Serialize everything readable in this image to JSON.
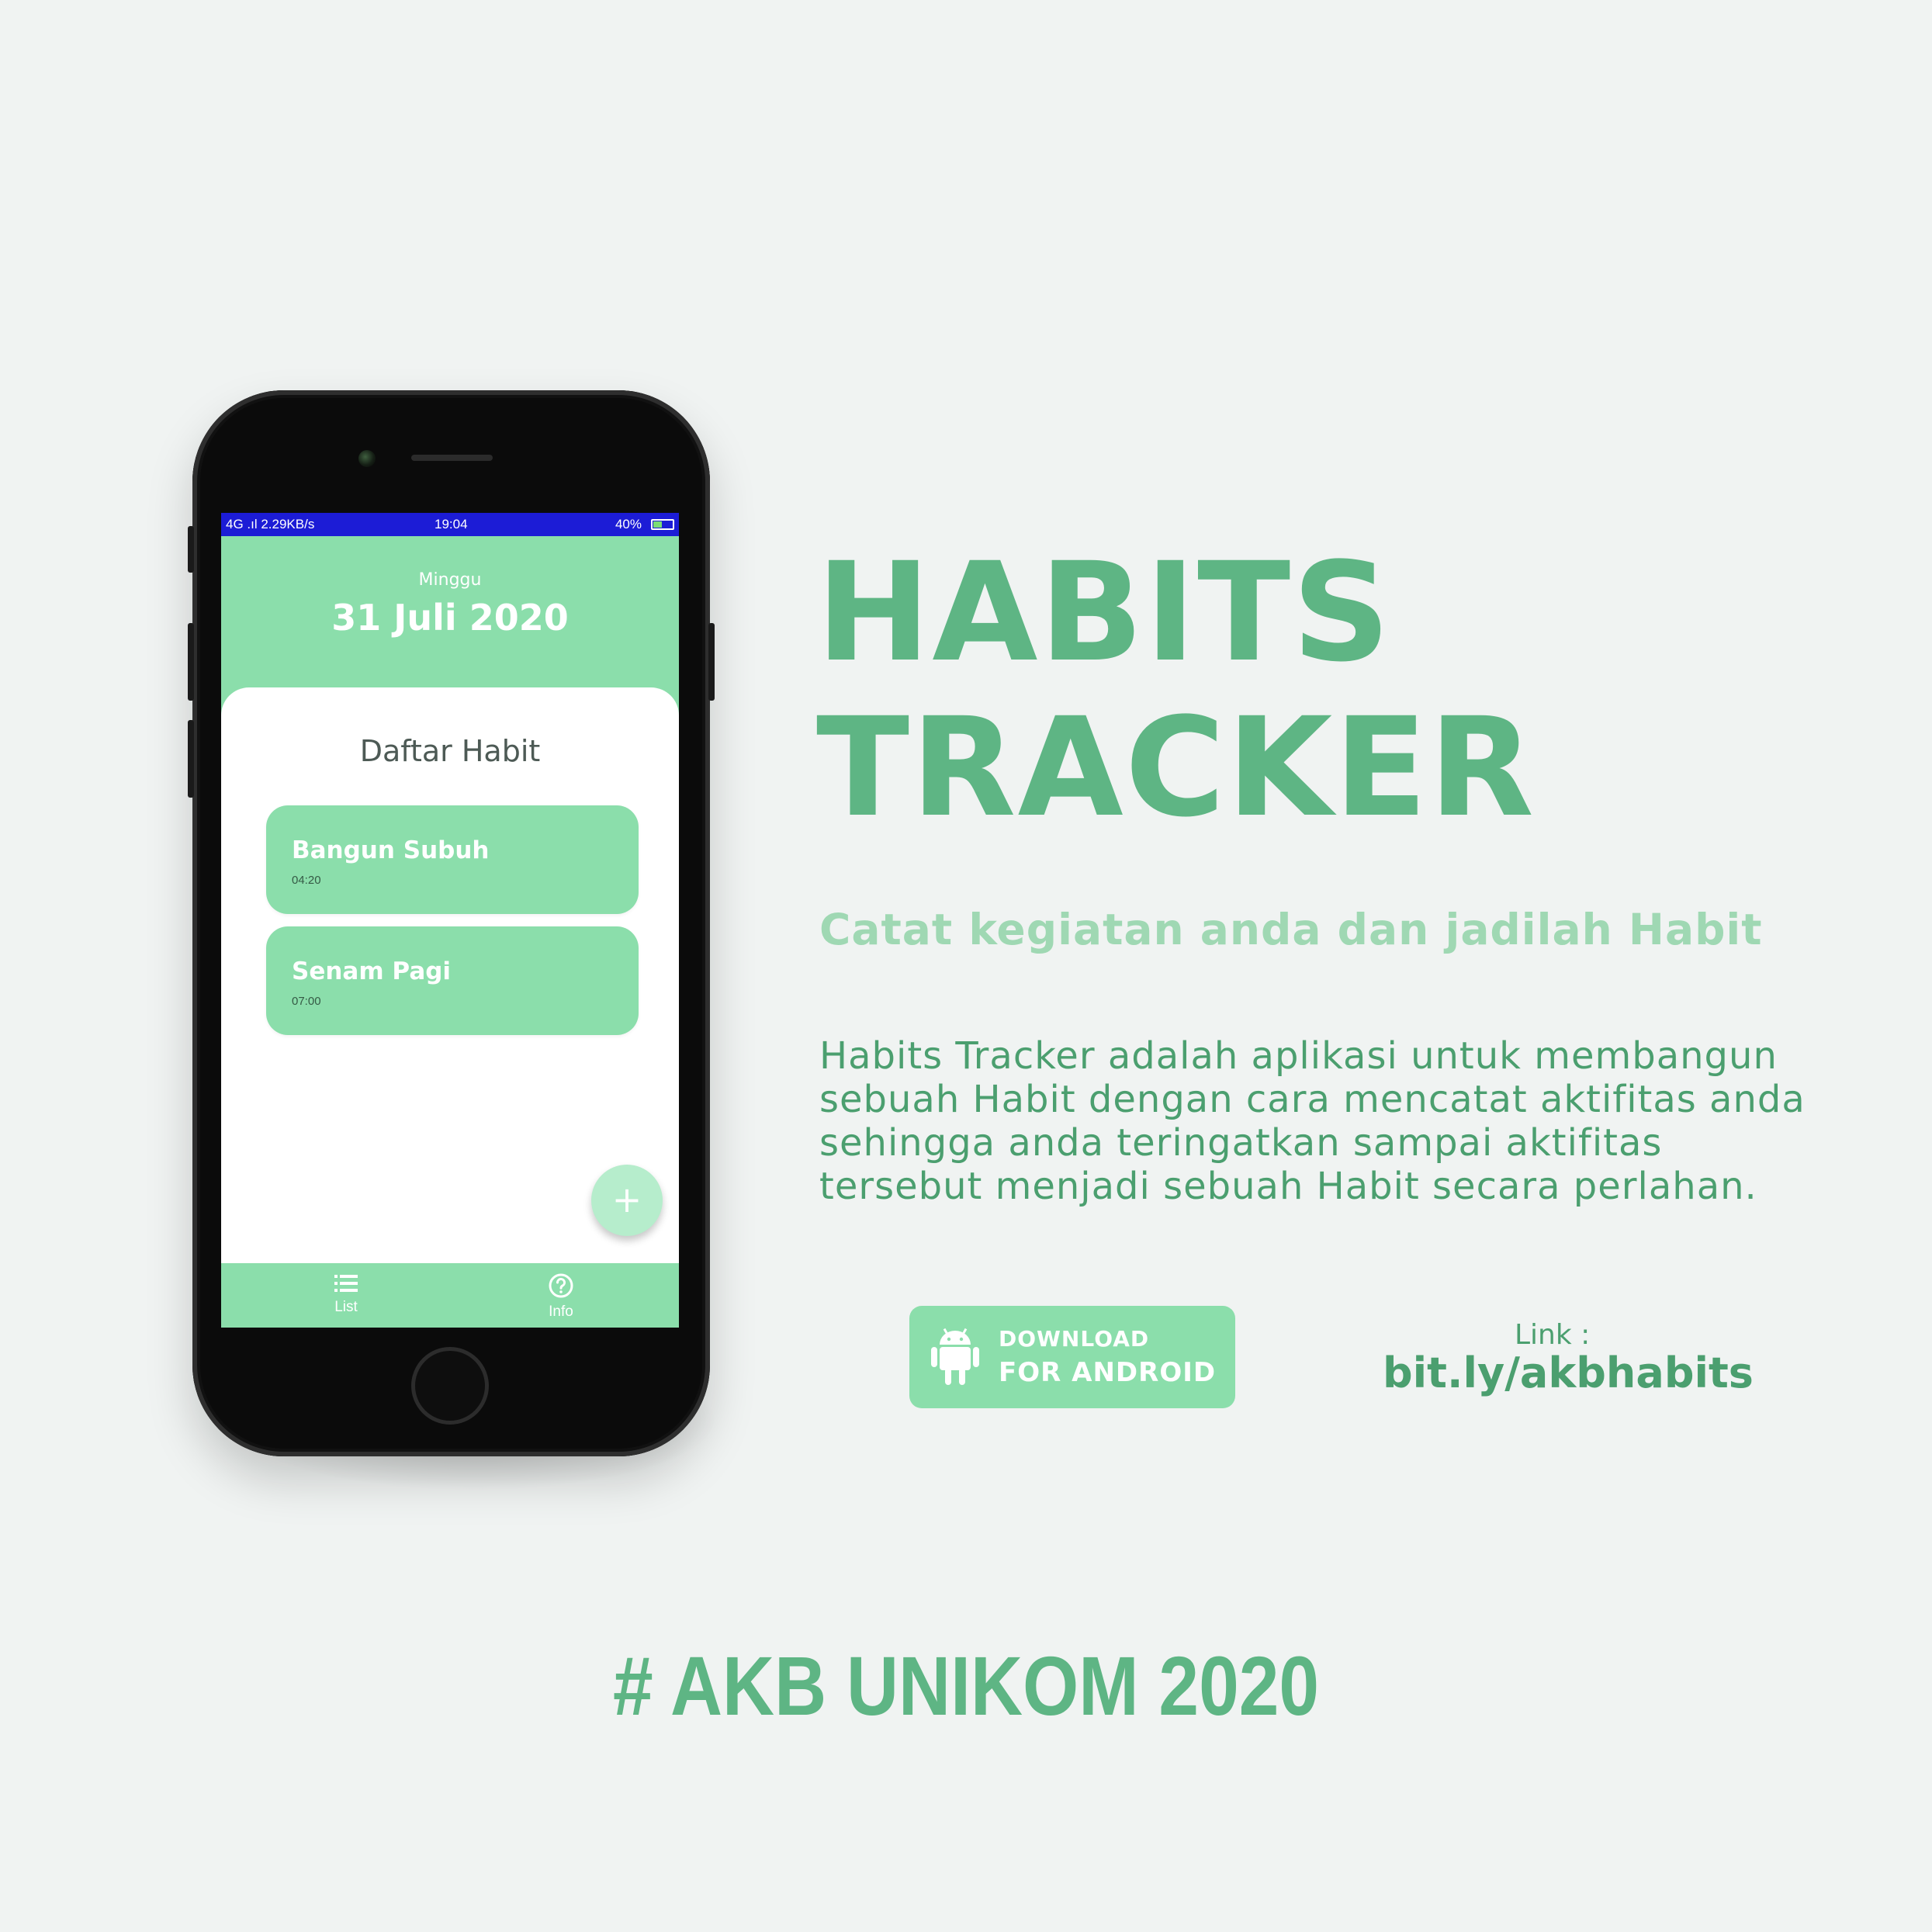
{
  "phone": {
    "status_bar": {
      "left": "4G .ıl 2.29KB/s",
      "time": "19:04",
      "right": "40%"
    },
    "header": {
      "day": "Minggu",
      "date": "31 Juli 2020"
    },
    "list_title": "Daftar Habit",
    "habits": [
      {
        "name": "Bangun Subuh",
        "time": "04:20"
      },
      {
        "name": "Senam Pagi",
        "time": "07:00"
      }
    ],
    "fab_icon": "plus-icon",
    "bottom_nav": [
      {
        "label": "List",
        "icon": "list-icon"
      },
      {
        "label": "Info",
        "icon": "help-circle-icon"
      }
    ]
  },
  "promo": {
    "title_line1": "HABITS",
    "title_line2": "TRACKER",
    "subtitle": "Catat kegiatan anda dan jadilah Habit",
    "description_lines": [
      "Habits Tracker adalah aplikasi untuk membangun",
      "sebuah Habit dengan cara mencatat aktifitas anda",
      "sehingga anda teringatkan sampai aktifitas",
      "tersebut menjadi sebuah Habit secara perlahan."
    ],
    "download_line1": "DOWNLOAD",
    "download_line2": "FOR ANDROID",
    "download_icon": "android-icon",
    "link_label": "Link :",
    "link_url": "bit.ly/akbhabits",
    "footer": "# AKB UNIKOM 2020"
  },
  "colors": {
    "accent": "#5eb584",
    "app_green": "#8bdeab",
    "subtitle": "#9fd8b3",
    "text_green": "#4b9f6f",
    "background": "#f0f3f2",
    "status_bar": "#1c1cd6"
  }
}
